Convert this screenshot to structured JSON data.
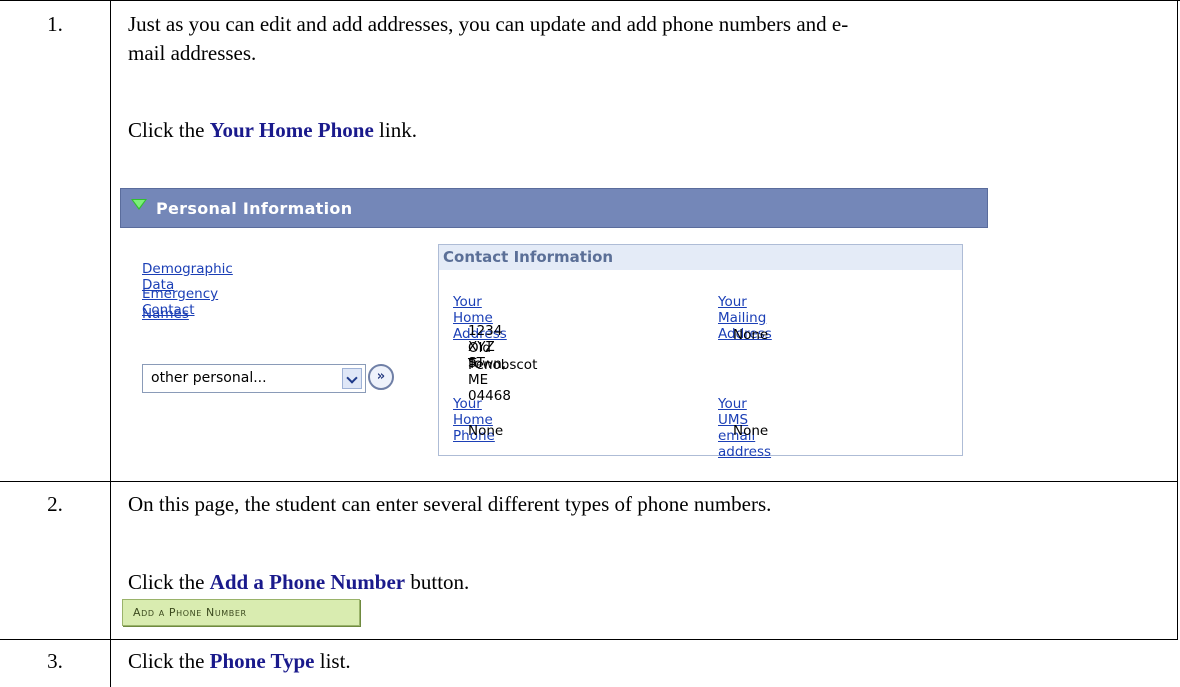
{
  "steps": [
    {
      "number": "1.",
      "lines": [
        "Just as you can edit and add addresses, you can update and add phone numbers and e-",
        "mail addresses."
      ],
      "instruction_prefix": "Click the ",
      "instruction_target": "Your Home Phone",
      "instruction_suffix": " link."
    },
    {
      "number": "2.",
      "line": "On this page, the student can enter several different types of phone numbers.",
      "instruction_prefix": "Click the ",
      "instruction_target": "Add a Phone Number",
      "instruction_suffix": " button."
    },
    {
      "number": "3.",
      "instruction_prefix": "Click the ",
      "instruction_target": "Phone Type",
      "instruction_suffix": " list."
    }
  ],
  "personal_info": {
    "title": "Personal Information",
    "links": [
      "Demographic Data",
      "Emergency Contact",
      "Names"
    ],
    "select_value": "other personal...",
    "go_icon": "double-chevron-right",
    "contact": {
      "title": "Contact Information",
      "home_address_label": "Your Home Address",
      "home_address_lines": [
        "1234 XYZ ST",
        "Old Town, ME 04468",
        "Penobscot"
      ],
      "mailing_address_label": "Your Mailing Address",
      "mailing_address_value": "None",
      "home_phone_label": "Your Home Phone",
      "home_phone_value": "None",
      "email_label": "Your UMS email address",
      "email_value": "None"
    }
  },
  "add_phone_button": "Add a Phone Number",
  "colors": {
    "header_bg": "#7487b8",
    "link": "#1b3fb6",
    "reference_text": "#1a1a8c",
    "button_bg": "#d9ecb0"
  }
}
